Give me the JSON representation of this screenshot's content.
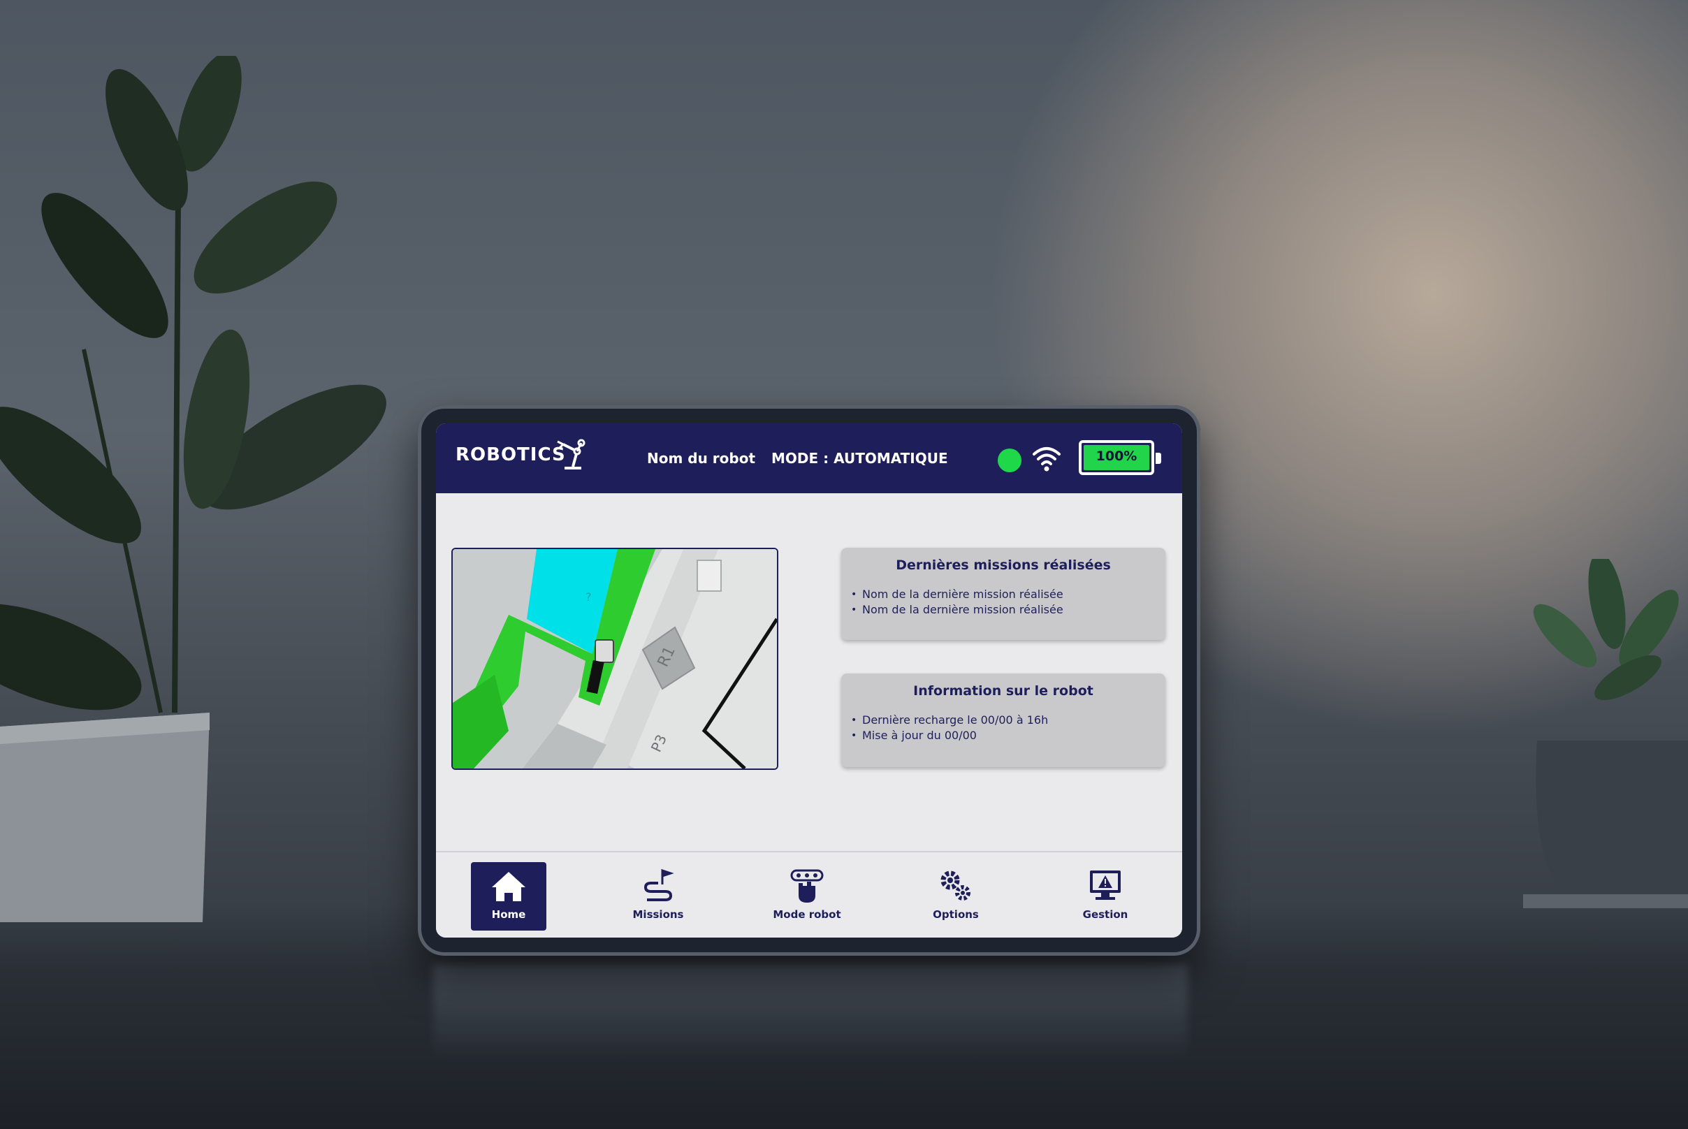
{
  "header": {
    "brand": "ROBOTICS",
    "robot_name": "Nom du robot",
    "mode": "MODE : AUTOMATIQUE",
    "connection_status_color": "#1fd84a",
    "battery": {
      "label": "100%",
      "level": 1.0,
      "color": "#21d44a"
    }
  },
  "map": {
    "labels": {
      "zone": "R1",
      "bay": "P3",
      "marker": "?"
    },
    "colors": {
      "robot_path": "#2ecc2e",
      "target_zone": "#00e0e8"
    }
  },
  "missions_card": {
    "title": "Dernières missions réalisées",
    "items": [
      "Nom de la dernière mission réalisée",
      "Nom de la dernière mission réalisée"
    ]
  },
  "info_card": {
    "title": "Information sur le robot",
    "items": [
      "Dernière recharge le 00/00 à 16h",
      "Mise à jour du 00/00"
    ]
  },
  "nav": {
    "items": [
      {
        "label": "Home",
        "icon": "home-icon",
        "active": true
      },
      {
        "label": "Missions",
        "icon": "route-flag-icon",
        "active": false
      },
      {
        "label": "Mode robot",
        "icon": "robot-hand-icon",
        "active": false
      },
      {
        "label": "Options",
        "icon": "gears-icon",
        "active": false
      },
      {
        "label": "Gestion",
        "icon": "monitor-warning-icon",
        "active": false
      }
    ]
  },
  "theme": {
    "primary": "#1e1f5a",
    "screen_bg": "#eaeaec",
    "card_bg": "#c9c9cb"
  }
}
